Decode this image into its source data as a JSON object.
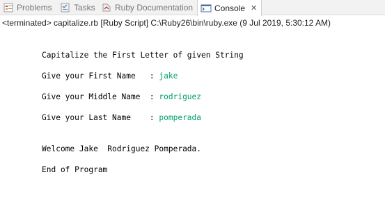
{
  "tabs": [
    {
      "label": "Problems",
      "icon": "problems-icon",
      "active": false
    },
    {
      "label": "Tasks",
      "icon": "tasks-icon",
      "active": false
    },
    {
      "label": "Ruby Documentation",
      "icon": "ruby-doc-icon",
      "active": false
    },
    {
      "label": "Console",
      "icon": "console-icon",
      "active": true,
      "close": "✕"
    }
  ],
  "status": "<terminated> capitalize.rb [Ruby Script] C:\\Ruby26\\bin\\ruby.exe (9 Jul 2019, 5:30:12 AM)",
  "console": {
    "heading": "Capitalize the First Letter of given String",
    "prompts": [
      {
        "label": "Give your First Name   : ",
        "value": "jake"
      },
      {
        "label": "Give your Middle Name  : ",
        "value": "rodriguez"
      },
      {
        "label": "Give your Last Name    : ",
        "value": "pomperada"
      }
    ],
    "welcome": "Welcome Jake  Rodriguez Pomperada.",
    "end": "End of Program"
  },
  "colors": {
    "input_text": "#00a06e",
    "active_tab_bg": "#ffffff",
    "tabbar_bg": "#f2f2f2"
  }
}
